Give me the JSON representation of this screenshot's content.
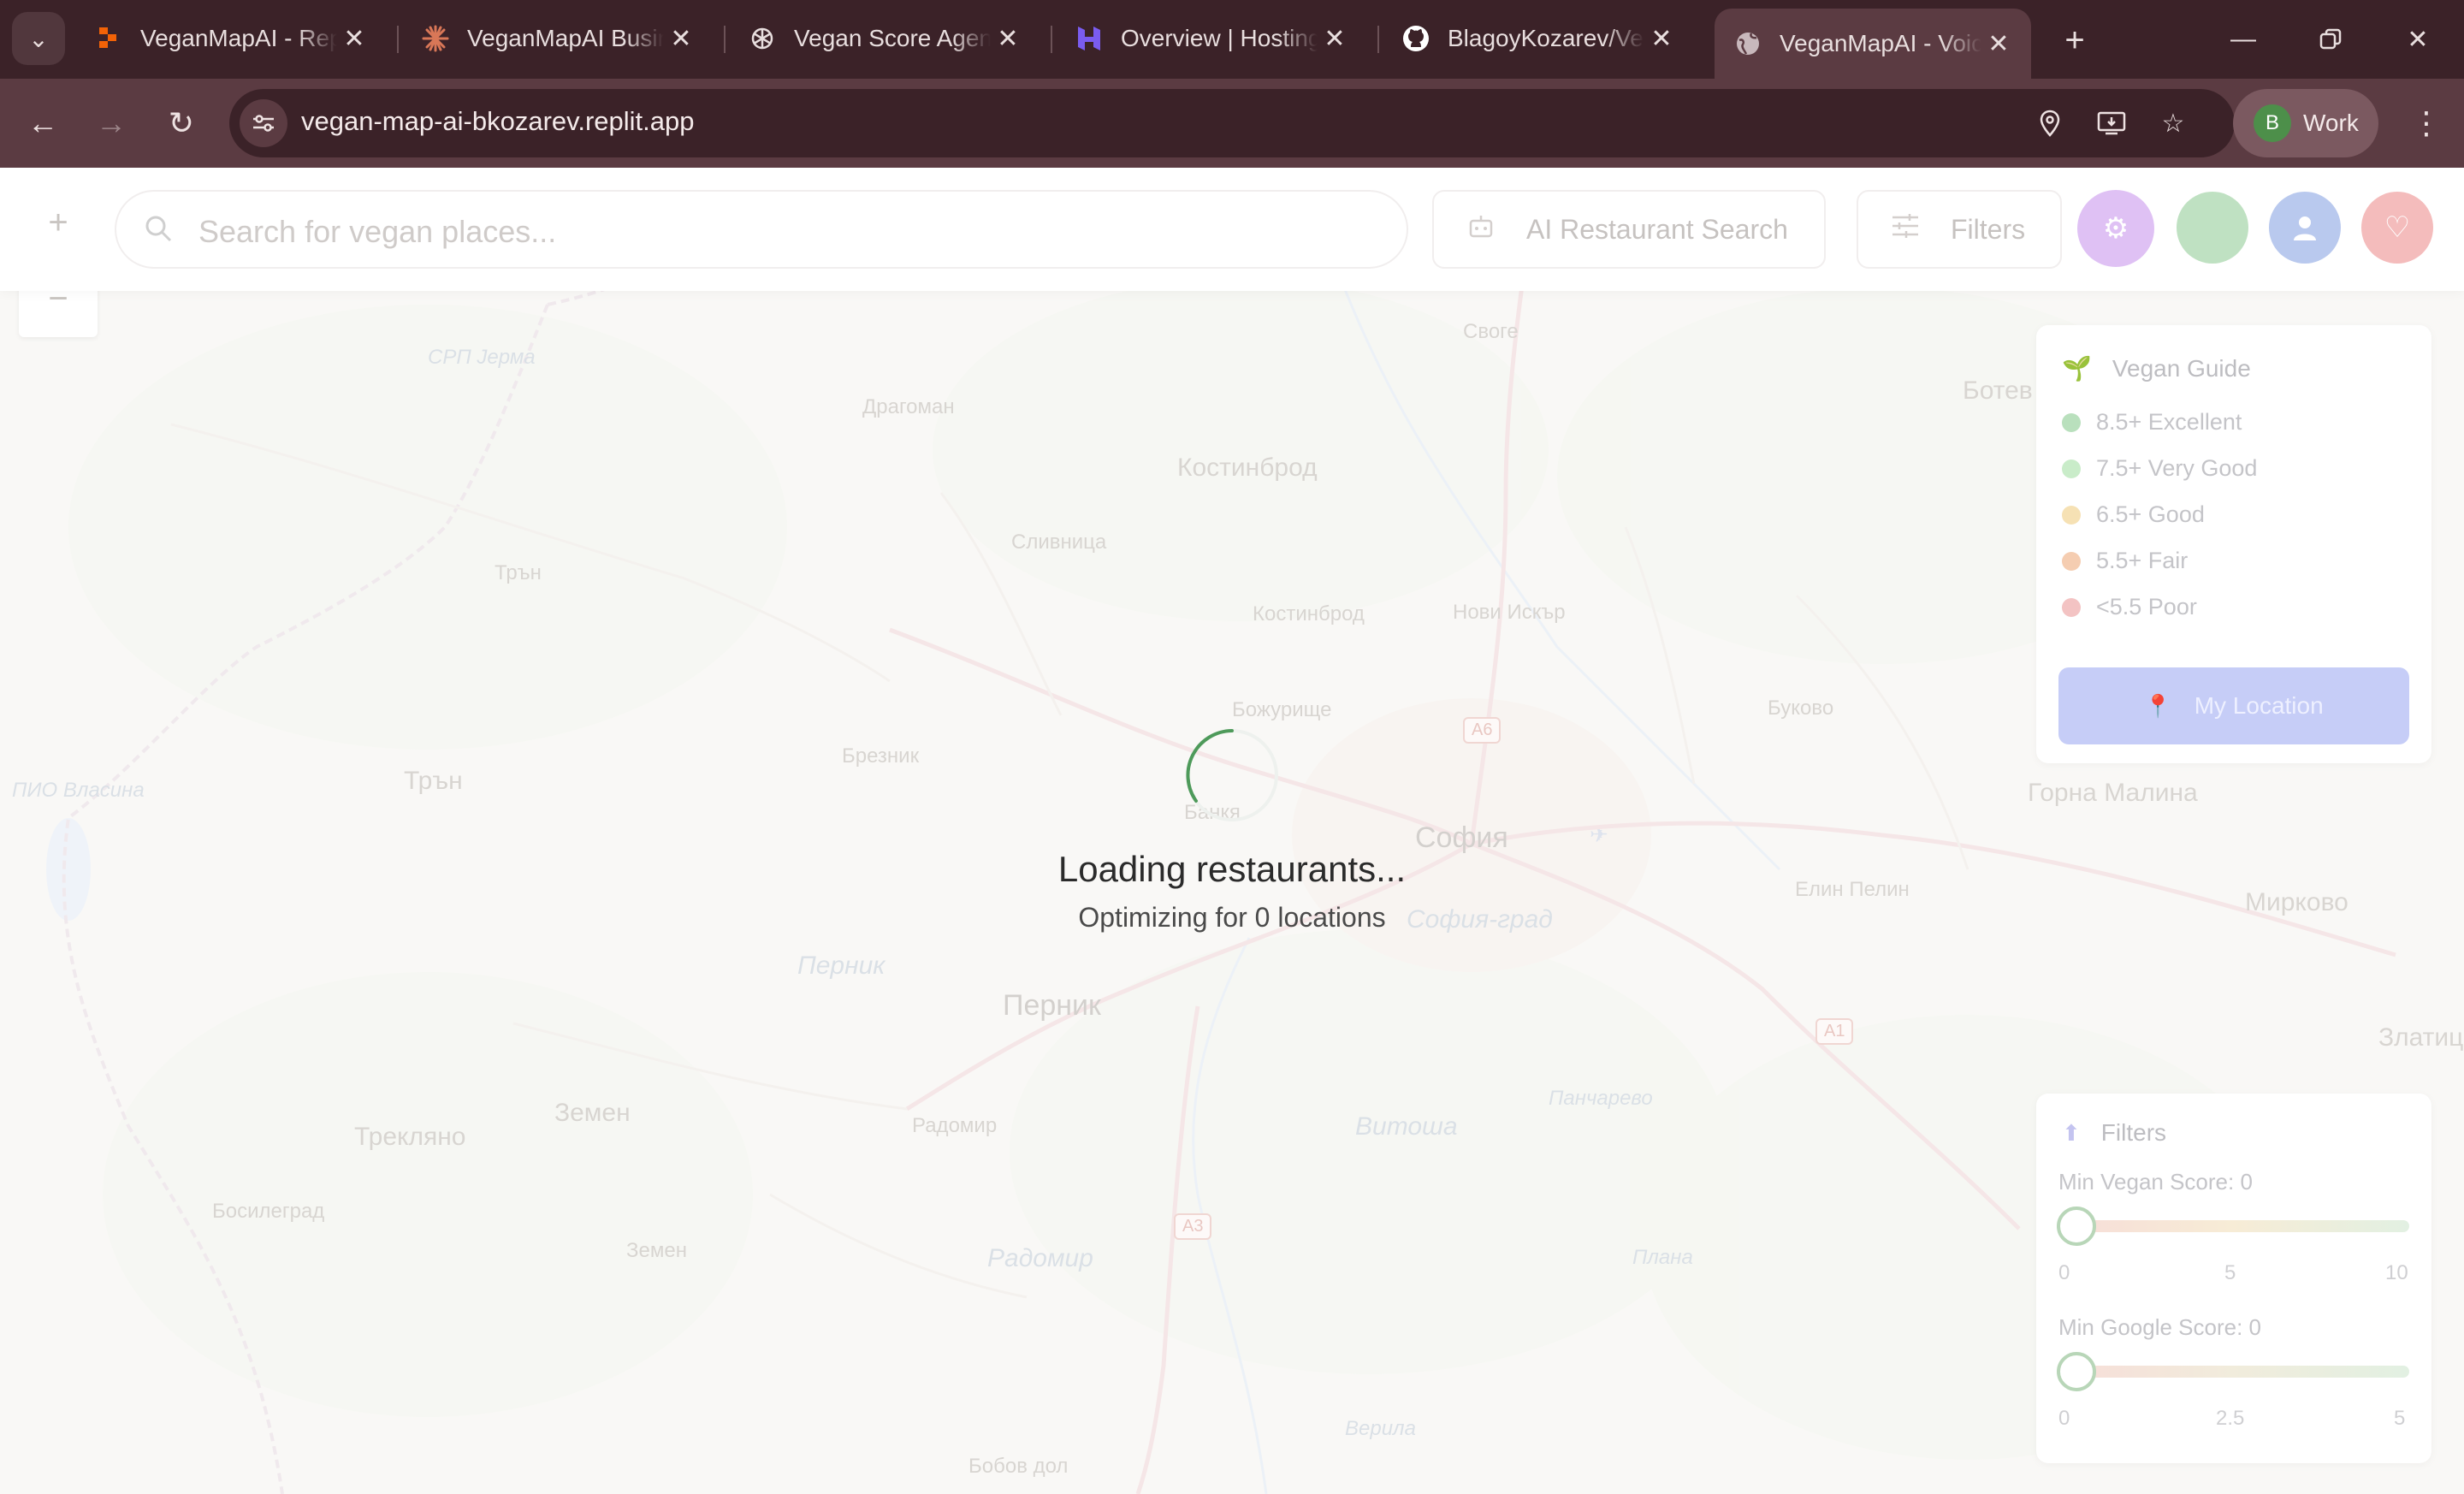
{
  "browser": {
    "tabs": [
      {
        "title": "VeganMapAI - Replit",
        "favicon": "replit-icon",
        "color": "#f26207"
      },
      {
        "title": "VeganMapAI Business Plan",
        "favicon": "claude-icon",
        "color": "#d97757"
      },
      {
        "title": "Vegan Score Agent",
        "favicon": "openai-icon",
        "color": "#ffffff"
      },
      {
        "title": "Overview | Hostinger",
        "favicon": "hostinger-icon",
        "color": "#673de6"
      },
      {
        "title": "BlagoyKozarev/VeganMapAI",
        "favicon": "github-icon",
        "color": "#ffffff"
      },
      {
        "title": "VeganMapAI - Voice",
        "favicon": "globe-icon",
        "color": "#c8b8bc",
        "active": true
      }
    ],
    "url": "vegan-map-ai-bkozarev.replit.app",
    "profile_initial": "B",
    "profile_label": "Work"
  },
  "app": {
    "search_placeholder": "Search for vegan places...",
    "ai_search_label": "AI Restaurant Search",
    "filters_button_label": "Filters",
    "zoom_in": "+",
    "zoom_out": "−",
    "legend": {
      "title": "Vegan Guide",
      "items": [
        {
          "label": "8.5+ Excellent",
          "color": "#b9e0bd"
        },
        {
          "label": "7.5+ Very Good",
          "color": "#c9ecc9"
        },
        {
          "label": "6.5+ Good",
          "color": "#f6e1b4"
        },
        {
          "label": "5.5+ Fair",
          "color": "#f5cdb1"
        },
        {
          "label": "<5.5 Poor",
          "color": "#f3c3c3"
        }
      ],
      "my_location_label": "My Location"
    },
    "filters_panel": {
      "title": "Filters",
      "vegan_label": "Min Vegan Score: 0",
      "vegan_ticks": [
        "0",
        "5",
        "10"
      ],
      "vegan_value": 0,
      "google_label": "Min Google Score: 0",
      "google_ticks": [
        "0",
        "2.5",
        "5"
      ],
      "google_value": 0
    },
    "loading": {
      "title": "Loading restaurants...",
      "subtitle": "Optimizing for 0 locations"
    }
  },
  "map_labels": {
    "labels": [
      "СРП Јерма",
      "Драгоман",
      "Сливница",
      "Костинброд",
      "Своге",
      "Ботев",
      "Трън",
      "Костинброд",
      "Нови Искър",
      "Божурище",
      "Брезник",
      "Банкя",
      "Буково",
      "ПИО Власина",
      "Трън",
      "София",
      "София-град",
      "Горна Малина",
      "Елин Пелин",
      "Мирково",
      "Перник",
      "Перник",
      "Панчарево",
      "Витоша",
      "Земен",
      "Трекляно",
      "Радомир",
      "Златица",
      "Босилеград",
      "Земен",
      "Радомир",
      "Плана",
      "Верила",
      "Бобов дол"
    ],
    "shields": [
      "A6",
      "A1",
      "A3"
    ]
  }
}
